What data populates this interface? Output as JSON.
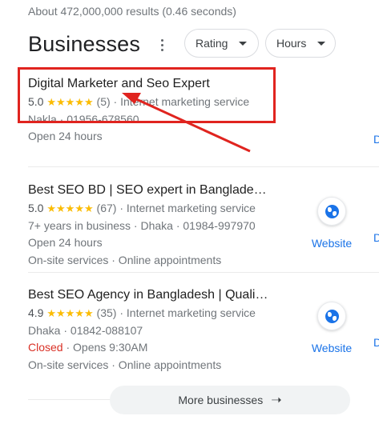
{
  "results_stats": "About 472,000,000 results (0.46 seconds)",
  "section": {
    "title": "Businesses",
    "filters": [
      {
        "label": "Rating"
      },
      {
        "label": "Hours"
      }
    ]
  },
  "listings": [
    {
      "name": "Digital Marketer and Seo Expert",
      "rating": "5.0",
      "stars": "★★★★★",
      "reviews": "(5)",
      "category": "Internet marketing service",
      "detail": "Nakla · 01956-678560",
      "hours": "Open 24 hours"
    },
    {
      "name": "Best SEO BD | SEO expert in Banglade…",
      "rating": "5.0",
      "stars": "★★★★★",
      "reviews": "(67)",
      "category": "Internet marketing service",
      "detail": "7+ years in business · Dhaka · 01984-997970",
      "hours": "Open 24 hours",
      "services": "On-site services · Online appointments",
      "website_label": "Website"
    },
    {
      "name": "Best SEO Agency in Bangladesh | Quali…",
      "rating": "4.9",
      "stars": "★★★★★",
      "reviews": "(35)",
      "category": "Internet marketing service",
      "detail": "Dhaka · 01842-088107",
      "status_closed": "Closed",
      "status_opens": " · Opens 9:30AM",
      "services": "On-site services · Online appointments",
      "website_label": "Website"
    }
  ],
  "directions_stub": "D",
  "more_button": {
    "label": "More businesses",
    "icon": "arrow-right-icon"
  },
  "colors": {
    "annotation": "#e0241f",
    "link": "#1a73e8",
    "star": "#fbbc04",
    "closed": "#d93025"
  }
}
